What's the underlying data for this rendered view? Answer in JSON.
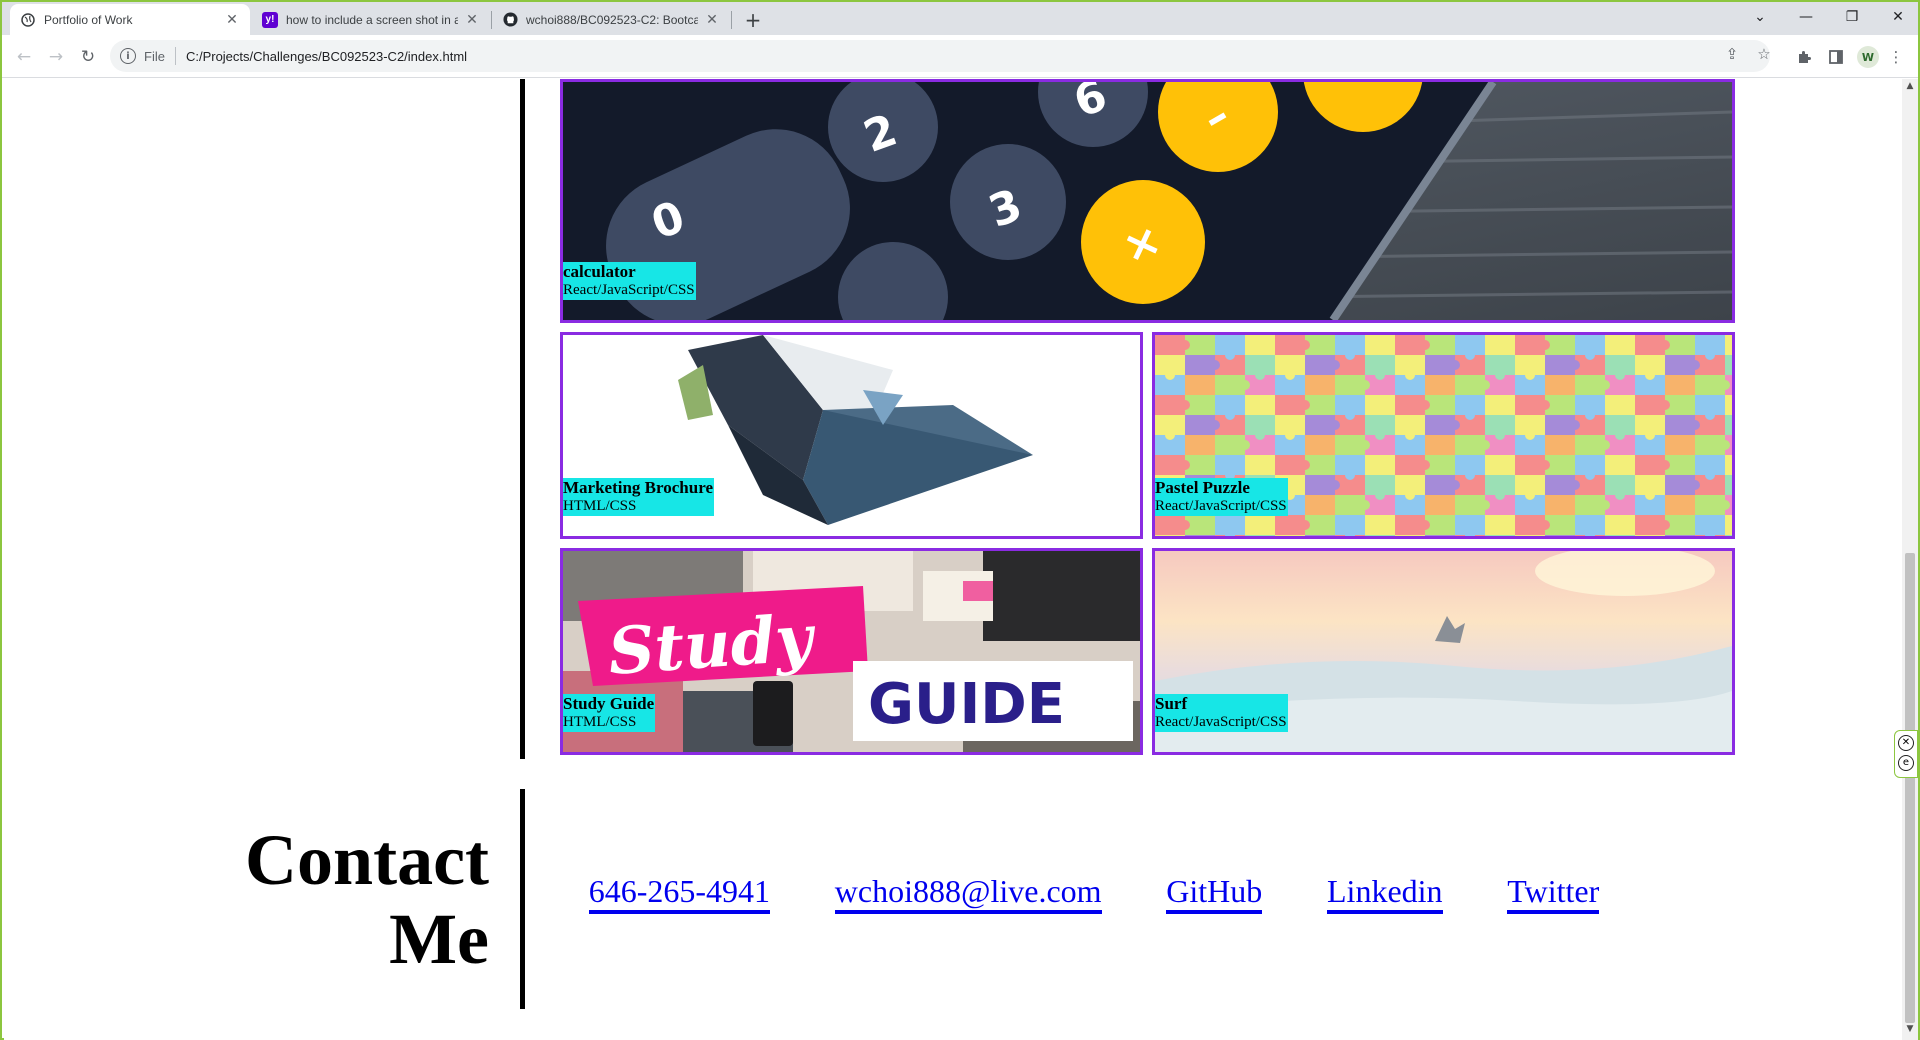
{
  "browser": {
    "tabs": [
      {
        "title": "Portfolio of Work",
        "favicon": "globe-icon",
        "active": true
      },
      {
        "title": "how to include a screen shot in a",
        "favicon": "yahoo-icon",
        "active": false
      },
      {
        "title": "wchoi888/BC092523-C2: Bootca",
        "favicon": "github-icon",
        "active": false
      }
    ],
    "new_tab_symbol": "+",
    "omnibox": {
      "scheme": "File",
      "url": "C:/Projects/Challenges/BC092523-C2/index.html"
    },
    "window_controls": {
      "list": "⌄",
      "minimize": "—",
      "restore": "❐",
      "close": "✕"
    }
  },
  "projects": [
    {
      "name": "calculator",
      "tech": "React/JavaScript/CSS"
    },
    {
      "name": "Marketing Brochure",
      "tech": "HTML/CSS"
    },
    {
      "name": "Pastel Puzzle",
      "tech": "React/JavaScript/CSS"
    },
    {
      "name": "Study Guide",
      "tech": "HTML/CSS"
    },
    {
      "name": "Surf",
      "tech": "React/JavaScript/CSS"
    }
  ],
  "study_guide_art": {
    "word1": "Study",
    "word2": "GUIDE"
  },
  "contact": {
    "title_line1": "Contact",
    "title_line2": "Me",
    "links": [
      {
        "label": "646-265-4941"
      },
      {
        "label": "wchoi888@live.com"
      },
      {
        "label": "GitHub"
      },
      {
        "label": "Linkedin"
      },
      {
        "label": "Twitter"
      }
    ]
  },
  "colors": {
    "card_border": "#8a2be2",
    "caption_bg": "#17e6e6",
    "link": "#0000ee",
    "window_border": "#8cc63f"
  }
}
